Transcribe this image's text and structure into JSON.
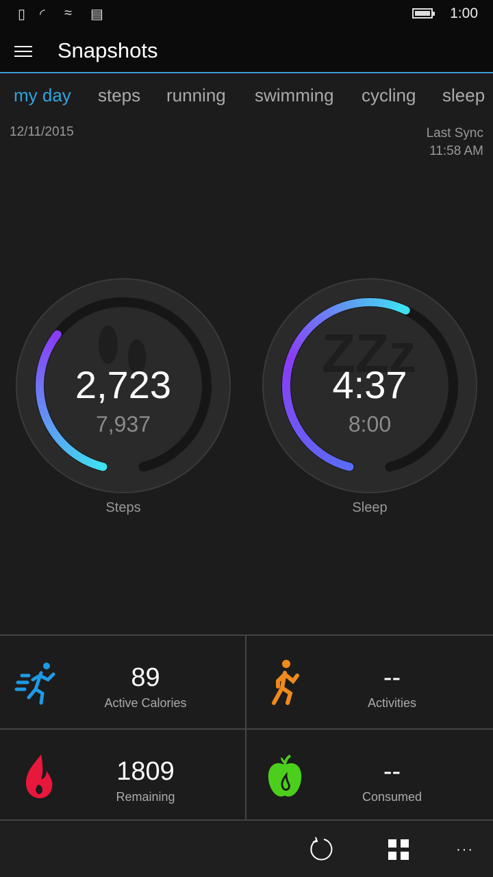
{
  "status_bar": {
    "time": "1:00",
    "icons": [
      "no-sim-icon",
      "wifi-icon",
      "data-sense-icon",
      "message-icon",
      "battery-icon"
    ]
  },
  "header": {
    "title": "Snapshots",
    "menu_icon": "hamburger-icon"
  },
  "tabs": [
    {
      "label": "my day",
      "active": true
    },
    {
      "label": "steps"
    },
    {
      "label": "running"
    },
    {
      "label": "swimming"
    },
    {
      "label": "cycling"
    },
    {
      "label": "sleep"
    }
  ],
  "date": "12/11/2015",
  "sync": {
    "label": "Last Sync",
    "time": "11:58 AM"
  },
  "gauges": [
    {
      "label": "Steps",
      "value": "2,723",
      "goal": "7,937",
      "progress": 0.343,
      "icon": "footprints-icon",
      "colors": [
        "#3fe0f0",
        "#8a3cf5"
      ]
    },
    {
      "label": "Sleep",
      "value": "4:37",
      "goal": "8:00",
      "progress": 0.577,
      "icon": "zzz-icon",
      "colors": [
        "#5a6cf5",
        "#8a3cf5",
        "#3fe0f0"
      ]
    }
  ],
  "stats": [
    {
      "value": "89",
      "label": "Active Calories",
      "icon": "running-fast-icon",
      "color": "#1e9ae6"
    },
    {
      "value": "--",
      "label": "Activities",
      "icon": "running-icon",
      "color": "#f08a1c"
    },
    {
      "value": "1809",
      "label": "Remaining",
      "icon": "flame-icon",
      "color": "#e8173c"
    },
    {
      "value": "--",
      "label": "Consumed",
      "icon": "apple-icon",
      "color": "#4ccf1c"
    }
  ],
  "appbar": {
    "buttons": [
      "sync-icon",
      "tiles-icon",
      "more-icon"
    ]
  }
}
